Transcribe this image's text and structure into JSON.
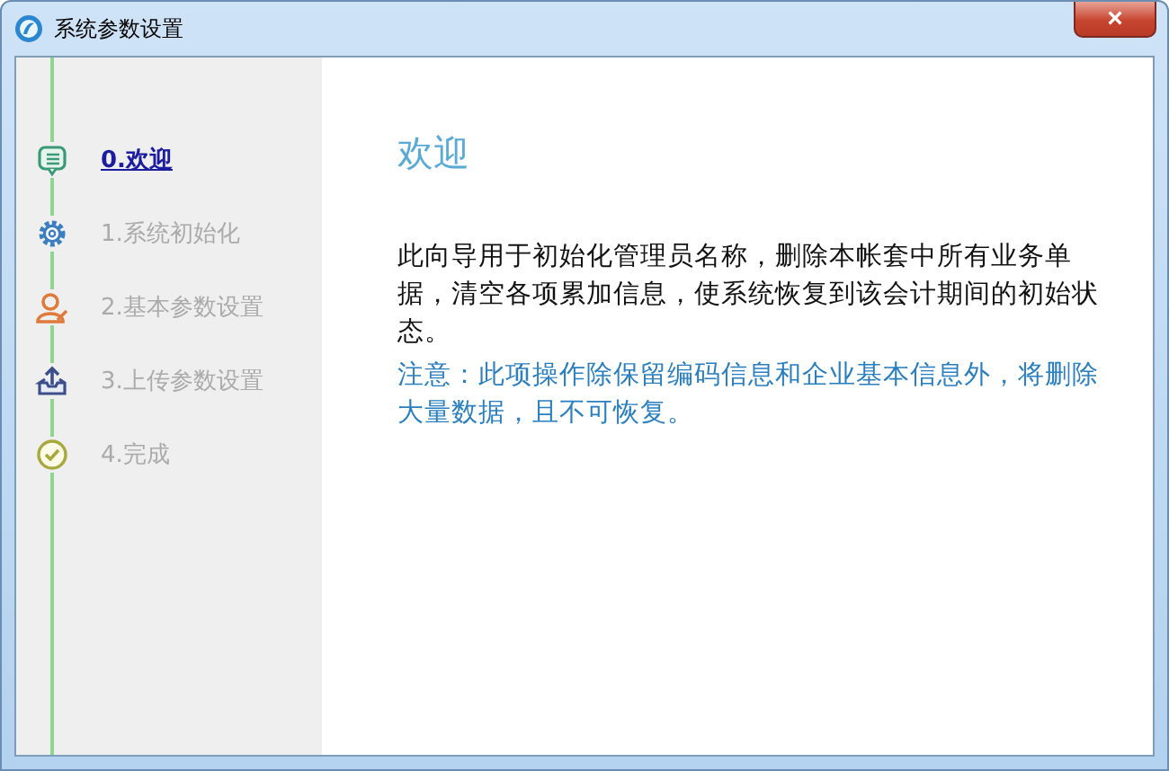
{
  "window": {
    "title": "系统参数设置",
    "close": "×"
  },
  "steps": [
    {
      "label": "0.欢迎",
      "kind": "list",
      "selected": true
    },
    {
      "label": "1.系统初始化",
      "kind": "gear",
      "selected": false
    },
    {
      "label": "2.基本参数设置",
      "kind": "user",
      "selected": false
    },
    {
      "label": "3.上传参数设置",
      "kind": "upload",
      "selected": false
    },
    {
      "label": "4.完成",
      "kind": "check",
      "selected": false
    }
  ],
  "content": {
    "heading": "欢迎",
    "description": "此向导用于初始化管理员名称，删除本帐套中所有业务单据，清空各项累加信息，使系统恢复到该会计期间的初始状态。",
    "warning": "注意：此项操作除保留编码信息和企业基本信息外，将删除大量数据，且不可恢复。"
  }
}
